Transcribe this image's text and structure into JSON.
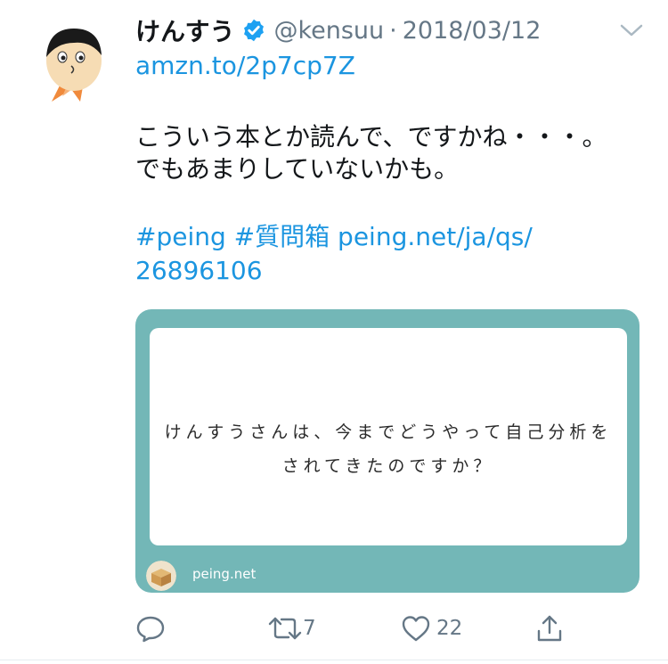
{
  "tweet": {
    "display_name": "けんすう",
    "handle": "@kensuu",
    "separator": "·",
    "date": "2018/03/12",
    "link1": "amzn.to/2p7cp7Z",
    "text_line1": "こういう本とか読んで、ですかね・・・。",
    "text_line2": "でもあまりしていないかも。",
    "hashtag1": "#peing",
    "hashtag2": "#質問箱",
    "link2_part1": "peing.net/ja/qs/",
    "link2_part2": "26896106"
  },
  "card": {
    "question_line1": "けんすうさんは、今までどうやって自己分析を",
    "question_line2": "されてきたのですか？",
    "domain": "peing.net"
  },
  "actions": {
    "retweet_count": "7",
    "like_count": "22"
  },
  "colors": {
    "link": "#1b95e0",
    "meta": "#657786",
    "card_bg": "#73b7b7",
    "verified": "#1da1f2"
  },
  "icons": [
    "verified-badge-icon",
    "chevron-down-icon",
    "reply-icon",
    "retweet-icon",
    "like-icon",
    "share-icon"
  ]
}
